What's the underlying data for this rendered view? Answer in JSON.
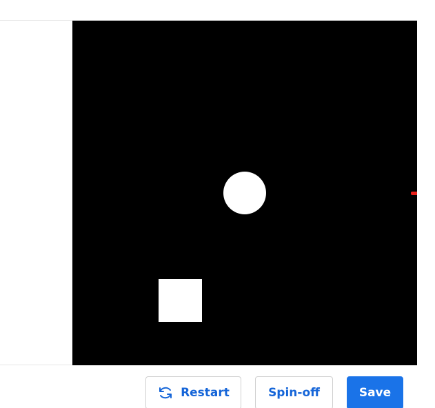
{
  "toolbar": {
    "restart_label": "Restart",
    "spinoff_label": "Spin-off",
    "save_label": "Save",
    "restart_icon": "restart-icon"
  },
  "canvas": {
    "background_color": "#000000",
    "shape_color": "#ffffff",
    "marker_color": "#e8201a",
    "shapes": [
      "circle",
      "square",
      "marker"
    ]
  },
  "colors": {
    "accent": "#1a73e8",
    "accent_text": "#1565d8"
  }
}
